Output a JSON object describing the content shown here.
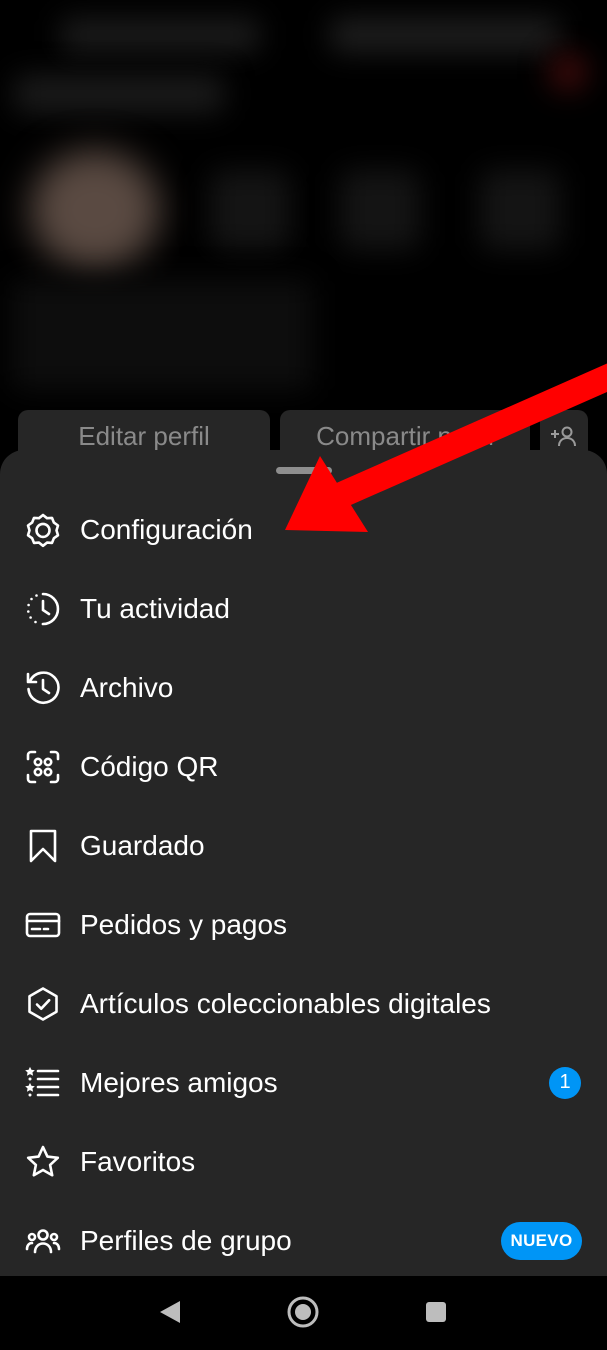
{
  "profile": {
    "edit_profile": "Editar perfil",
    "share_profile": "Compartir perfil",
    "add_person_icon": "add-person-icon"
  },
  "menu": {
    "items": [
      {
        "label": "Configuración",
        "icon": "settings-gear-icon"
      },
      {
        "label": "Tu actividad",
        "icon": "activity-clock-icon"
      },
      {
        "label": "Archivo",
        "icon": "archive-history-icon"
      },
      {
        "label": "Código QR",
        "icon": "qr-code-icon"
      },
      {
        "label": "Guardado",
        "icon": "bookmark-icon"
      },
      {
        "label": "Pedidos y pagos",
        "icon": "card-icon"
      },
      {
        "label": "Artículos coleccionables digitales",
        "icon": "verified-badge-icon"
      },
      {
        "label": "Mejores amigos",
        "icon": "close-friends-list-icon",
        "badge": "1"
      },
      {
        "label": "Favoritos",
        "icon": "star-icon"
      },
      {
        "label": "Perfiles de grupo",
        "icon": "group-icon",
        "badge": "NUEVO"
      }
    ]
  },
  "colors": {
    "sheet": "#262626",
    "accent_blue": "#0095f6",
    "annotation_red": "#ff0000"
  },
  "navbar": {
    "back_icon": "back-triangle-icon",
    "home_icon": "home-circle-icon",
    "recents_icon": "recents-square-icon"
  }
}
